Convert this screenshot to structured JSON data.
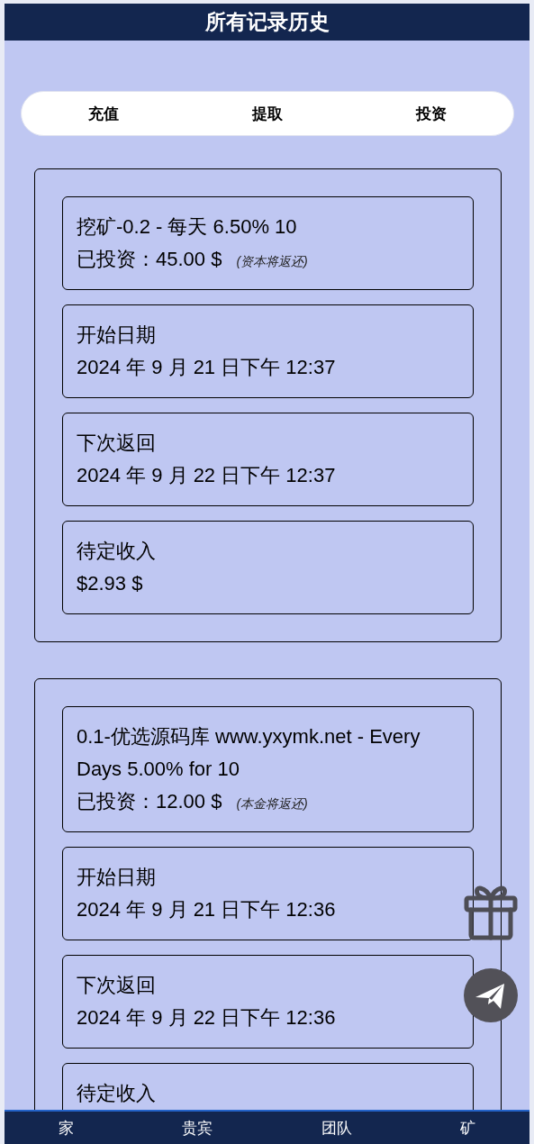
{
  "header": {
    "title": "所有记录历史"
  },
  "tabs": [
    {
      "label": "充值",
      "selected": false
    },
    {
      "label": "提取",
      "selected": false
    },
    {
      "label": "投资",
      "selected": false
    }
  ],
  "records": [
    {
      "title": "挖矿-0.2 - 每天 6.50% 10",
      "invested": "已投资：45.00 $",
      "note": "(资本将返还)",
      "fields": [
        {
          "label": "开始日期",
          "value": "2024 年 9 月 21 日下午 12:37"
        },
        {
          "label": "下次返回",
          "value": "2024 年 9 月 22 日下午 12:37"
        },
        {
          "label": "待定收入",
          "value": "$2.93 $"
        }
      ]
    },
    {
      "title": "0.1-优选源码库 www.yxymk.net - Every Days 5.00% for 10",
      "invested": "已投资：12.00 $",
      "note": "(本金将返还)",
      "fields": [
        {
          "label": "开始日期",
          "value": "2024 年 9 月 21 日下午 12:36"
        },
        {
          "label": "下次返回",
          "value": "2024 年 9 月 22 日下午 12:36"
        },
        {
          "label": "待定收入"
        }
      ]
    }
  ],
  "bottom_nav": [
    {
      "label": "家"
    },
    {
      "label": "贵宾"
    },
    {
      "label": "团队"
    },
    {
      "label": "矿"
    }
  ]
}
